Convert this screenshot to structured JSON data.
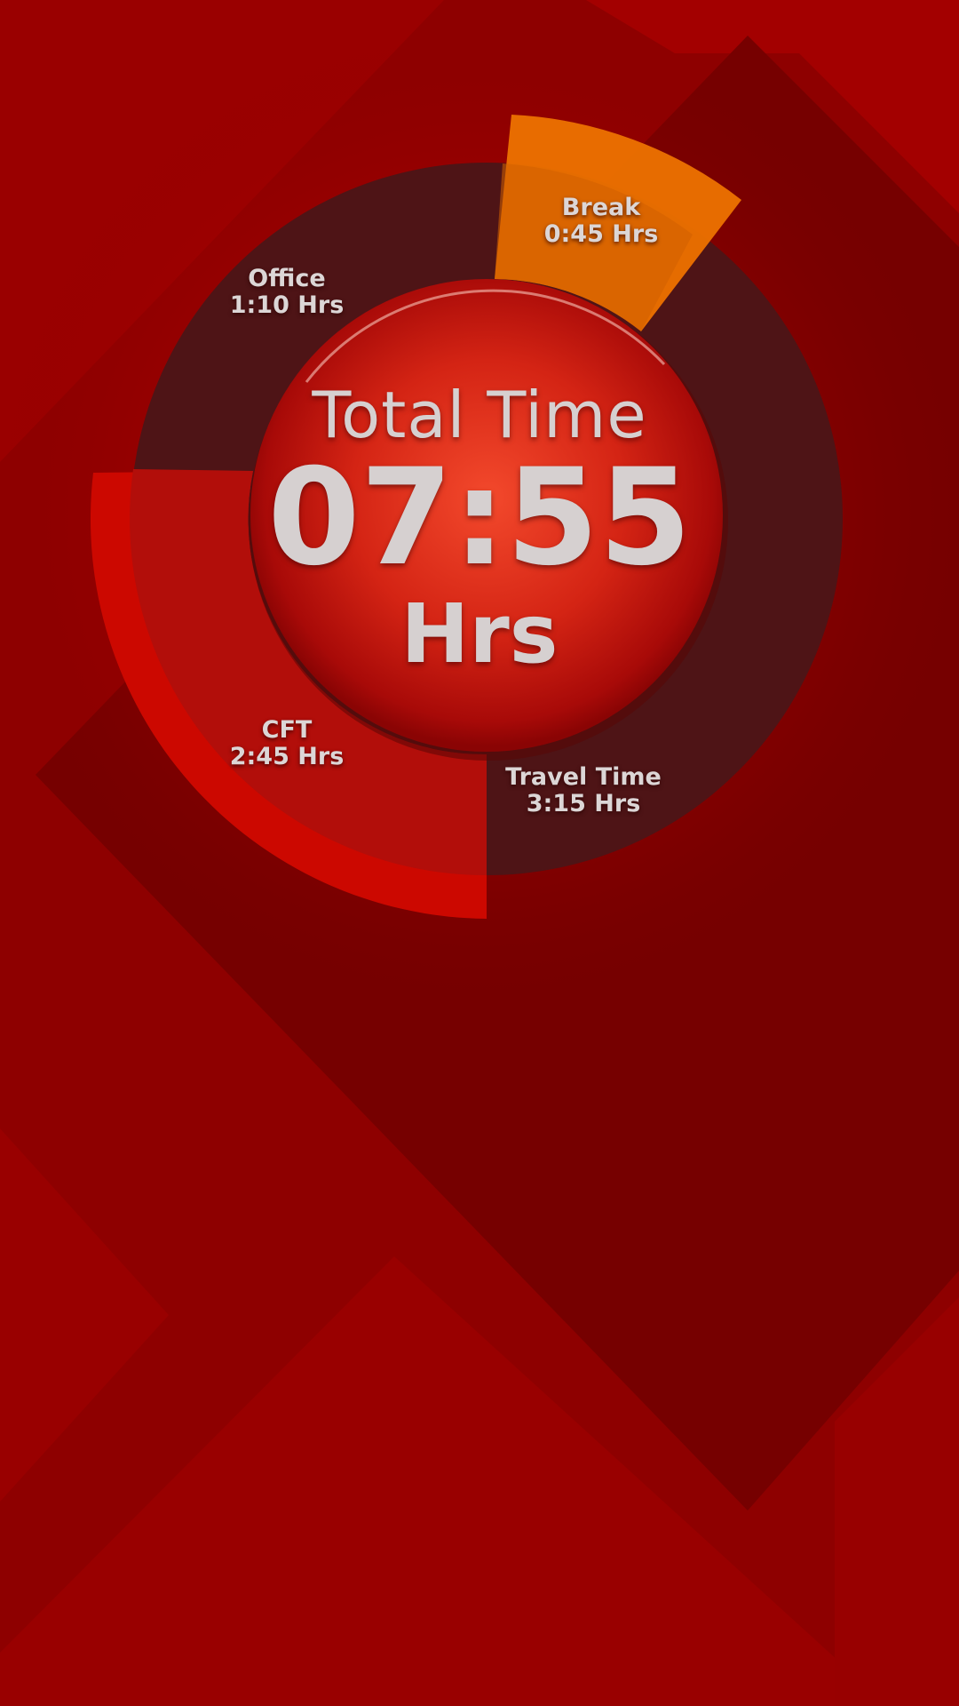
{
  "colors": {
    "background": "#8a0000",
    "ring_dark": "#4e1416",
    "break_segment": "#ea7000",
    "cft_segment": "#cc0800",
    "center_disc": "#e83a24",
    "text": "#d6d0d0"
  },
  "center": {
    "title": "Total Time",
    "value": "07:55",
    "unit": "Hrs"
  },
  "segments": [
    {
      "name": "Break",
      "duration": "0:45 Hrs"
    },
    {
      "name": "Office",
      "duration": "1:10 Hrs"
    },
    {
      "name": "CFT",
      "duration": "2:45 Hrs"
    },
    {
      "name": "Travel Time",
      "duration": "3:15 Hrs"
    }
  ]
}
